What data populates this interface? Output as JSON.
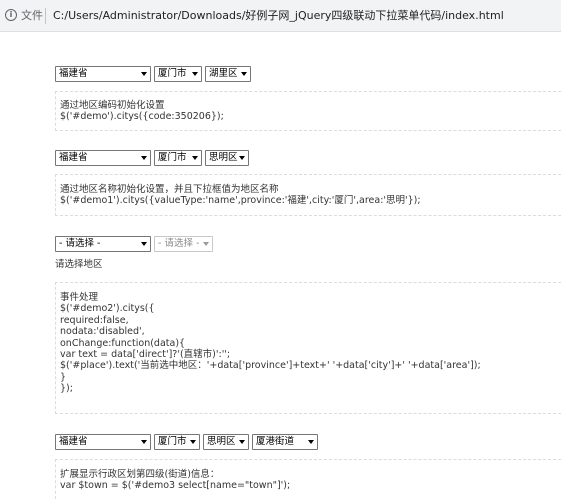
{
  "browser": {
    "scheme_label": "文件",
    "url": "C:/Users/Administrator/Downloads/好例子网_jQuery四级联动下拉菜单代码/index.html"
  },
  "demo1": {
    "province": "福建省",
    "city": "厦门市",
    "area": "湖里区",
    "code_lines": [
      "通过地区编码初始化设置",
      "$('#demo').citys({code:350206});"
    ]
  },
  "demo2": {
    "province": "福建省",
    "city": "厦门市",
    "area": "思明区",
    "code_lines": [
      "通过地区名称初始化设置，并且下拉框值为地区名称",
      "$('#demo1').citys({valueType:'name',province:'福建',city:'厦门',area:'思明'});"
    ]
  },
  "demo3": {
    "province": "- 请选择 -",
    "city": "- 请选择 -",
    "place_text": "请选择地区",
    "code_lines": [
      "事件处理",
      "$('#demo2').citys({",
      "required:false,",
      "nodata:'disabled',",
      "onChange:function(data){",
      "var text = data['direct']?'(直辖市)':'';",
      "$('#place').text('当前选中地区：'+data['province']+text+' '+data['city']+' '+data['area']);",
      "}",
      "});"
    ]
  },
  "demo4": {
    "province": "福建省",
    "city": "厦门市",
    "area": "思明区",
    "town": "厦港街道",
    "code_lines": [
      "扩展显示行政区划第四级(街道)信息：",
      "var $town = $('#demo3 select[name=\"town\"]');"
    ]
  }
}
